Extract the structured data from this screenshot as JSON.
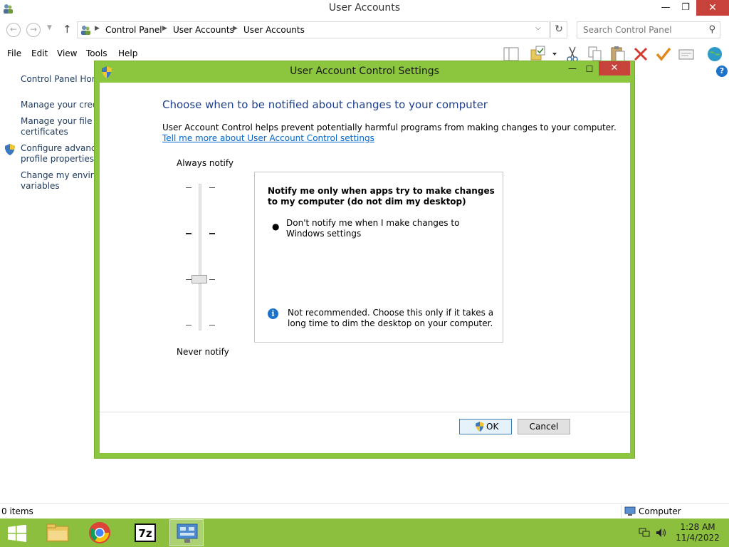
{
  "window": {
    "title": "User Accounts",
    "min_glyph": "—",
    "max_glyph": "❐",
    "close_glyph": "✕"
  },
  "address": {
    "breadcrumbs": [
      "Control Panel",
      "User Accounts",
      "User Accounts"
    ],
    "search_placeholder": "Search Control Panel"
  },
  "menu": [
    "File",
    "Edit",
    "View",
    "Tools",
    "Help"
  ],
  "sidebar": {
    "items": [
      {
        "label": "Control Panel Home"
      },
      {
        "label": "Manage your credentials"
      },
      {
        "label": "Manage your file encryption"
      },
      {
        "label": "certificates"
      },
      {
        "label": "Configure advanced user"
      },
      {
        "label": "profile properties"
      },
      {
        "label": "Change my environment"
      },
      {
        "label": "variables"
      }
    ]
  },
  "status": {
    "items": "0 items",
    "location": "Computer"
  },
  "taskbar": {
    "time": "1:28 AM",
    "date": "11/4/2022"
  },
  "dialog": {
    "title": "User Account Control Settings",
    "heading": "Choose when to be notified about changes to your computer",
    "description": "User Account Control helps prevent potentially harmful programs from making changes to your computer.",
    "link": "Tell me more about User Account Control settings",
    "slider": {
      "top_label": "Always notify",
      "bottom_label": "Never notify",
      "level": 3,
      "levels": 4
    },
    "info": {
      "title": "Notify me only when apps try to make changes to my computer (do not dim my desktop)",
      "bullet": "Don't notify me when I make changes to Windows settings",
      "warning": "Not recommended. Choose this only if it takes a long time to dim the desktop on your computer."
    },
    "ok_label": "OK",
    "cancel_label": "Cancel"
  },
  "colors": {
    "accent_green": "#8cc63f",
    "taskbar_green": "#8cbf3e",
    "close_red": "#c7423a",
    "heading_blue": "#1e3f8c",
    "link_blue": "#0066cc"
  }
}
